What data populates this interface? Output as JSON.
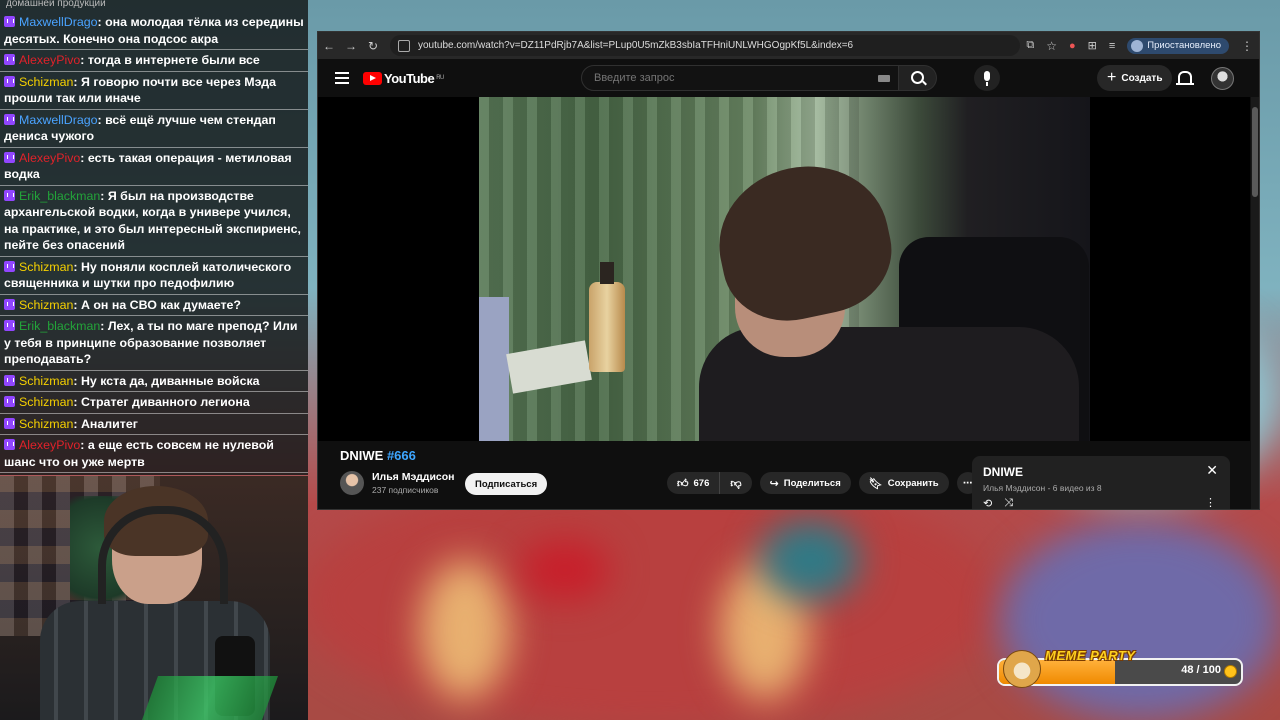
{
  "chat": {
    "header": "домашней продукции",
    "messages": [
      {
        "user": "MaxwellDrago",
        "color": "#4aa3ff",
        "text": ": она молодая тёлка из середины десятых. Конечно она подсос акра"
      },
      {
        "user": "AlexeyPivo",
        "color": "#e0222a",
        "text": ": тогда в интернете были все"
      },
      {
        "user": "Schizman",
        "color": "#f5d000",
        "text": ": Я говорю почти все через Мэда прошли так или иначе"
      },
      {
        "user": "MaxwellDrago",
        "color": "#4aa3ff",
        "text": ": всё ещё лучше чем стендап дениса чужого"
      },
      {
        "user": "AlexeyPivo",
        "color": "#e0222a",
        "text": ": есть такая операция - метиловая водка"
      },
      {
        "user": "Erik_blackman",
        "color": "#23a43a",
        "text": ": Я был на производстве архангельской водки, когда в универе учился, на практике, и это был интересный экспириенс, пейте без опасений"
      },
      {
        "user": "Schizman",
        "color": "#f5d000",
        "text": ": Ну поняли косплей католического священника и шутки про педофилию"
      },
      {
        "user": "Schizman",
        "color": "#f5d000",
        "text": ": А он на СВО как думаете?"
      },
      {
        "user": "Erik_blackman",
        "color": "#23a43a",
        "text": ": Лех, а ты по маге препод? Или у тебя в принципе образование позволяет преподавать?"
      },
      {
        "user": "Schizman",
        "color": "#f5d000",
        "text": ": Ну кста да, диванные войска"
      },
      {
        "user": "Schizman",
        "color": "#f5d000",
        "text": ": Стратег диванного легиона"
      },
      {
        "user": "Schizman",
        "color": "#f5d000",
        "text": ": Аналитег"
      },
      {
        "user": "AlexeyPivo",
        "color": "#e0222a",
        "text": ": а еще есть совсем не нулевой шанс что он уже мертв"
      }
    ]
  },
  "browser": {
    "url": "youtube.com/watch?v=DZ11PdRjb7A&list=PLup0U5mZkB3sbIaTFHniUNLWHGOgpKf5L&index=6",
    "profile_status": "Приостановлено"
  },
  "youtube": {
    "logo_text": "YouTube",
    "logo_region": "RU",
    "search_placeholder": "Введите запрос",
    "create_label": "Создать",
    "video_title": "DNIWE ",
    "video_tag": "#666",
    "channel_name": "Илья Мэддисон",
    "channel_subs": "237 подписчиков",
    "subscribe_label": "Подписаться",
    "likes": "676",
    "share_label": "Поделиться",
    "save_label": "Сохранить",
    "playlist": {
      "title": "DNIWE",
      "meta": "Илья Мэддисон - 6 видео из 8"
    }
  },
  "meme_party": {
    "title": "MEME PARTY",
    "count_text": "48 / 100",
    "progress": 0.48
  },
  "icons": {
    "back": "arrow-left-icon",
    "forward": "arrow-right-icon",
    "reload": "reload-icon",
    "star": "star-icon",
    "extensions": "puzzle-icon",
    "menu": "more-vertical-icon"
  }
}
